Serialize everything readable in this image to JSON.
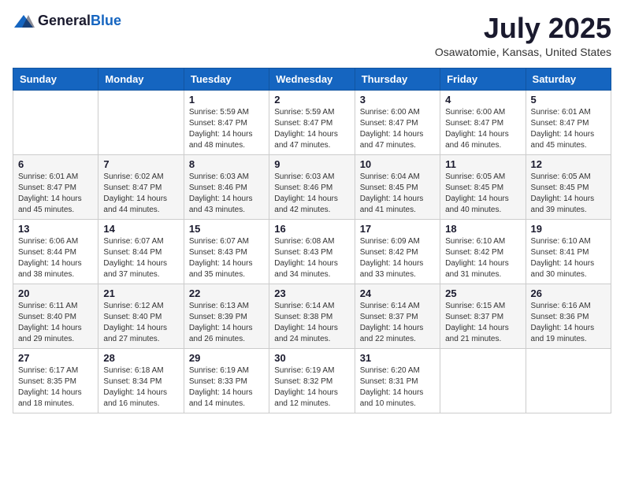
{
  "header": {
    "logo_general": "General",
    "logo_blue": "Blue",
    "month_title": "July 2025",
    "location": "Osawatomie, Kansas, United States"
  },
  "weekdays": [
    "Sunday",
    "Monday",
    "Tuesday",
    "Wednesday",
    "Thursday",
    "Friday",
    "Saturday"
  ],
  "weeks": [
    [
      {
        "day": "",
        "info": ""
      },
      {
        "day": "",
        "info": ""
      },
      {
        "day": "1",
        "info": "Sunrise: 5:59 AM\nSunset: 8:47 PM\nDaylight: 14 hours and 48 minutes."
      },
      {
        "day": "2",
        "info": "Sunrise: 5:59 AM\nSunset: 8:47 PM\nDaylight: 14 hours and 47 minutes."
      },
      {
        "day": "3",
        "info": "Sunrise: 6:00 AM\nSunset: 8:47 PM\nDaylight: 14 hours and 47 minutes."
      },
      {
        "day": "4",
        "info": "Sunrise: 6:00 AM\nSunset: 8:47 PM\nDaylight: 14 hours and 46 minutes."
      },
      {
        "day": "5",
        "info": "Sunrise: 6:01 AM\nSunset: 8:47 PM\nDaylight: 14 hours and 45 minutes."
      }
    ],
    [
      {
        "day": "6",
        "info": "Sunrise: 6:01 AM\nSunset: 8:47 PM\nDaylight: 14 hours and 45 minutes."
      },
      {
        "day": "7",
        "info": "Sunrise: 6:02 AM\nSunset: 8:47 PM\nDaylight: 14 hours and 44 minutes."
      },
      {
        "day": "8",
        "info": "Sunrise: 6:03 AM\nSunset: 8:46 PM\nDaylight: 14 hours and 43 minutes."
      },
      {
        "day": "9",
        "info": "Sunrise: 6:03 AM\nSunset: 8:46 PM\nDaylight: 14 hours and 42 minutes."
      },
      {
        "day": "10",
        "info": "Sunrise: 6:04 AM\nSunset: 8:45 PM\nDaylight: 14 hours and 41 minutes."
      },
      {
        "day": "11",
        "info": "Sunrise: 6:05 AM\nSunset: 8:45 PM\nDaylight: 14 hours and 40 minutes."
      },
      {
        "day": "12",
        "info": "Sunrise: 6:05 AM\nSunset: 8:45 PM\nDaylight: 14 hours and 39 minutes."
      }
    ],
    [
      {
        "day": "13",
        "info": "Sunrise: 6:06 AM\nSunset: 8:44 PM\nDaylight: 14 hours and 38 minutes."
      },
      {
        "day": "14",
        "info": "Sunrise: 6:07 AM\nSunset: 8:44 PM\nDaylight: 14 hours and 37 minutes."
      },
      {
        "day": "15",
        "info": "Sunrise: 6:07 AM\nSunset: 8:43 PM\nDaylight: 14 hours and 35 minutes."
      },
      {
        "day": "16",
        "info": "Sunrise: 6:08 AM\nSunset: 8:43 PM\nDaylight: 14 hours and 34 minutes."
      },
      {
        "day": "17",
        "info": "Sunrise: 6:09 AM\nSunset: 8:42 PM\nDaylight: 14 hours and 33 minutes."
      },
      {
        "day": "18",
        "info": "Sunrise: 6:10 AM\nSunset: 8:42 PM\nDaylight: 14 hours and 31 minutes."
      },
      {
        "day": "19",
        "info": "Sunrise: 6:10 AM\nSunset: 8:41 PM\nDaylight: 14 hours and 30 minutes."
      }
    ],
    [
      {
        "day": "20",
        "info": "Sunrise: 6:11 AM\nSunset: 8:40 PM\nDaylight: 14 hours and 29 minutes."
      },
      {
        "day": "21",
        "info": "Sunrise: 6:12 AM\nSunset: 8:40 PM\nDaylight: 14 hours and 27 minutes."
      },
      {
        "day": "22",
        "info": "Sunrise: 6:13 AM\nSunset: 8:39 PM\nDaylight: 14 hours and 26 minutes."
      },
      {
        "day": "23",
        "info": "Sunrise: 6:14 AM\nSunset: 8:38 PM\nDaylight: 14 hours and 24 minutes."
      },
      {
        "day": "24",
        "info": "Sunrise: 6:14 AM\nSunset: 8:37 PM\nDaylight: 14 hours and 22 minutes."
      },
      {
        "day": "25",
        "info": "Sunrise: 6:15 AM\nSunset: 8:37 PM\nDaylight: 14 hours and 21 minutes."
      },
      {
        "day": "26",
        "info": "Sunrise: 6:16 AM\nSunset: 8:36 PM\nDaylight: 14 hours and 19 minutes."
      }
    ],
    [
      {
        "day": "27",
        "info": "Sunrise: 6:17 AM\nSunset: 8:35 PM\nDaylight: 14 hours and 18 minutes."
      },
      {
        "day": "28",
        "info": "Sunrise: 6:18 AM\nSunset: 8:34 PM\nDaylight: 14 hours and 16 minutes."
      },
      {
        "day": "29",
        "info": "Sunrise: 6:19 AM\nSunset: 8:33 PM\nDaylight: 14 hours and 14 minutes."
      },
      {
        "day": "30",
        "info": "Sunrise: 6:19 AM\nSunset: 8:32 PM\nDaylight: 14 hours and 12 minutes."
      },
      {
        "day": "31",
        "info": "Sunrise: 6:20 AM\nSunset: 8:31 PM\nDaylight: 14 hours and 10 minutes."
      },
      {
        "day": "",
        "info": ""
      },
      {
        "day": "",
        "info": ""
      }
    ]
  ]
}
